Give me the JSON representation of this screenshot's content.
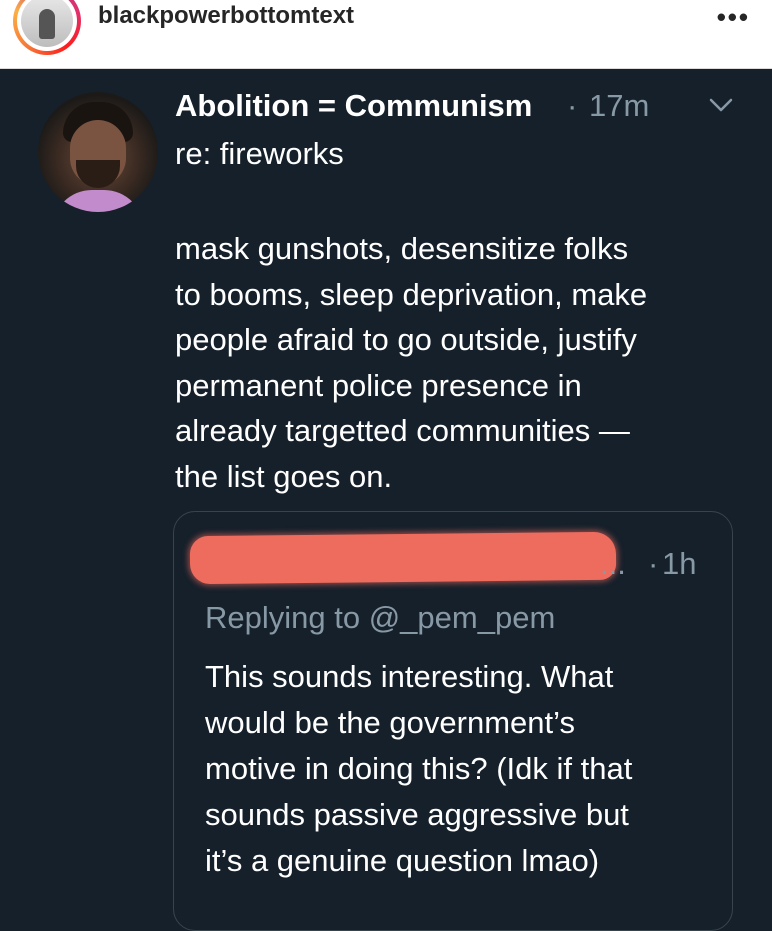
{
  "instagram": {
    "username": "blackpowerbottomtext",
    "more_icon": "•••"
  },
  "tweet": {
    "author_name": "Abolition = Communism",
    "separator": "·",
    "time": "17m",
    "reply_line": "re: fireworks",
    "body_lines": [
      "mask gunshots, desensitize folks",
      "to booms, sleep deprivation, make",
      "people afraid to go outside, justify",
      "permanent police presence in",
      "already targetted communities —",
      "the list goes on."
    ]
  },
  "quoted": {
    "truncated_suffix": "...",
    "separator": "·",
    "time": "1h",
    "replying_to": "Replying to @_pem_pem",
    "body_lines": [
      "This sounds interesting. What",
      "would be the government’s",
      "motive in doing this? (Idk if that",
      "sounds passive aggressive but",
      "it’s a genuine question lmao)"
    ]
  },
  "colors": {
    "background": "#15202b",
    "secondary_text": "#8899a6",
    "redaction": "#ee6c5e"
  }
}
